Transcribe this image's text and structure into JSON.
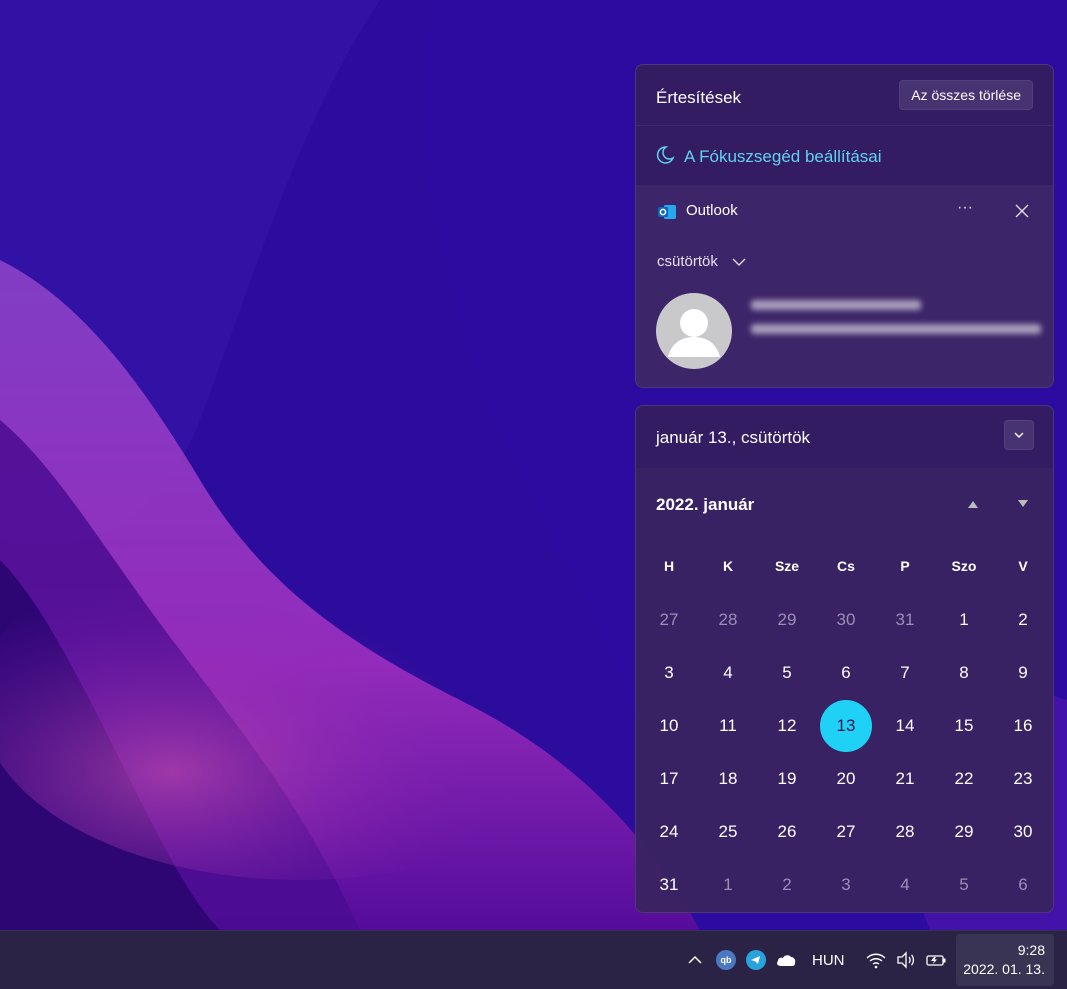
{
  "notifications": {
    "title": "Értesítések",
    "clear_all_label": "Az összes törlése",
    "focus_assist_label": "A Fókuszsegéd beállításai",
    "card": {
      "app_name": "Outlook",
      "more_label": "···",
      "group_label": "csütörtök"
    }
  },
  "calendar": {
    "date_title": "január 13., csütörtök",
    "month_title": "2022. január",
    "weekdays": [
      "H",
      "K",
      "Sze",
      "Cs",
      "P",
      "Szo",
      "V"
    ],
    "weeks": [
      [
        {
          "d": "27",
          "o": true
        },
        {
          "d": "28",
          "o": true
        },
        {
          "d": "29",
          "o": true
        },
        {
          "d": "30",
          "o": true
        },
        {
          "d": "31",
          "o": true
        },
        {
          "d": "1",
          "o": false
        },
        {
          "d": "2",
          "o": false
        }
      ],
      [
        {
          "d": "3",
          "o": false
        },
        {
          "d": "4",
          "o": false
        },
        {
          "d": "5",
          "o": false
        },
        {
          "d": "6",
          "o": false
        },
        {
          "d": "7",
          "o": false
        },
        {
          "d": "8",
          "o": false
        },
        {
          "d": "9",
          "o": false
        }
      ],
      [
        {
          "d": "10",
          "o": false
        },
        {
          "d": "11",
          "o": false
        },
        {
          "d": "12",
          "o": false
        },
        {
          "d": "13",
          "o": false,
          "today": true
        },
        {
          "d": "14",
          "o": false
        },
        {
          "d": "15",
          "o": false
        },
        {
          "d": "16",
          "o": false
        }
      ],
      [
        {
          "d": "17",
          "o": false
        },
        {
          "d": "18",
          "o": false
        },
        {
          "d": "19",
          "o": false
        },
        {
          "d": "20",
          "o": false
        },
        {
          "d": "21",
          "o": false
        },
        {
          "d": "22",
          "o": false
        },
        {
          "d": "23",
          "o": false
        }
      ],
      [
        {
          "d": "24",
          "o": false
        },
        {
          "d": "25",
          "o": false
        },
        {
          "d": "26",
          "o": false
        },
        {
          "d": "27",
          "o": false
        },
        {
          "d": "28",
          "o": false
        },
        {
          "d": "29",
          "o": false
        },
        {
          "d": "30",
          "o": false
        }
      ],
      [
        {
          "d": "31",
          "o": false
        },
        {
          "d": "1",
          "o": true
        },
        {
          "d": "2",
          "o": true
        },
        {
          "d": "3",
          "o": true
        },
        {
          "d": "4",
          "o": true
        },
        {
          "d": "5",
          "o": true
        },
        {
          "d": "6",
          "o": true
        }
      ]
    ],
    "today_color": "#1fd2f5"
  },
  "taskbar": {
    "tray_icons": [
      "chevron-up-icon",
      "qbittorrent-icon",
      "telegram-icon",
      "onedrive-cloud-icon",
      "wifi-icon",
      "volume-icon",
      "battery-charging-icon"
    ],
    "qb_label": "qb",
    "language": "HUN",
    "time": "9:28",
    "date": "2022. 01. 13."
  },
  "colors": {
    "accent": "#5fd3f0",
    "panel_bg": "#341e5c",
    "taskbar_bg": "#2a2346"
  }
}
